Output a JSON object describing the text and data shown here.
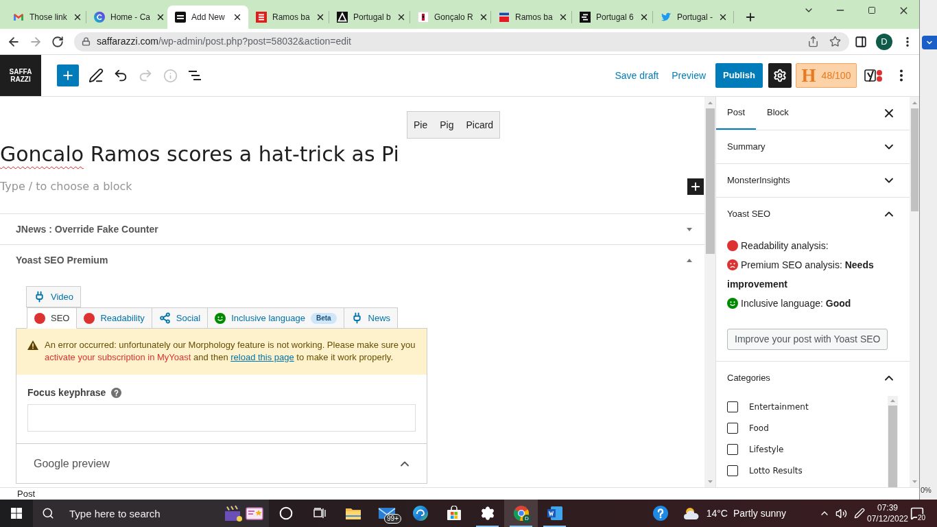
{
  "browser": {
    "tabs": [
      {
        "title": "Those link",
        "kind": "gmail",
        "selected": false
      },
      {
        "title": "Home - Ca",
        "kind": "canva",
        "selected": false
      },
      {
        "title": "Add New",
        "kind": "site",
        "selected": true
      },
      {
        "title": "Ramos ba",
        "kind": "red-bars",
        "selected": false
      },
      {
        "title": "Portugal b",
        "kind": "triangle",
        "selected": false
      },
      {
        "title": "Gonçalo R",
        "kind": "flag",
        "selected": false
      },
      {
        "title": "Ramos ba",
        "kind": "news",
        "selected": false
      },
      {
        "title": "Portugal 6",
        "kind": "dark-bars",
        "selected": false
      },
      {
        "title": "Portugal -",
        "kind": "bird",
        "selected": false
      }
    ],
    "nav": [
      {
        "kind": "back",
        "disabled": false
      },
      {
        "kind": "forward",
        "disabled": true
      },
      {
        "kind": "reload",
        "disabled": false
      }
    ],
    "url": {
      "host": "saffarazzi.com",
      "path": "/wp-admin/post.php?post=58032&action=edit"
    },
    "profile": "D"
  },
  "editor": {
    "logo": [
      "SAFFA",
      "RAZZI"
    ],
    "tools": [
      {
        "kind": "pen",
        "disabled": false
      },
      {
        "kind": "undo",
        "disabled": false
      },
      {
        "kind": "redo",
        "disabled": true
      },
      {
        "kind": "info",
        "disabled": true
      },
      {
        "kind": "list",
        "disabled": false
      }
    ],
    "save_draft": "Save draft",
    "preview": "Preview",
    "publish": "Publish",
    "score": {
      "logo": "H",
      "value": "48/100"
    }
  },
  "suggestions": [
    "Pie",
    "Pig",
    "Picard"
  ],
  "post": {
    "title": [
      {
        "text": "Goncalo",
        "misspelled": true
      },
      {
        "text": " Ramos scores a hat-trick as Pi",
        "misspelled": false
      }
    ],
    "placeholder": "Type / to choose a block"
  },
  "meta_boxes": [
    {
      "title": "JNews : Override Fake Counter",
      "expanded": false
    },
    {
      "title": "Yoast SEO Premium",
      "expanded": true,
      "tab_rows": [
        [
          {
            "label": "Video",
            "kind": "plug",
            "selected": false
          }
        ],
        [
          {
            "label": "SEO",
            "kind": "dot",
            "color": "#dc3232",
            "selected": true
          },
          {
            "label": "Readability",
            "kind": "dot",
            "color": "#dc3232",
            "selected": false
          },
          {
            "label": "Social",
            "kind": "share",
            "selected": false
          },
          {
            "label": "Inclusive language",
            "kind": "smile",
            "color": "#008a00",
            "badge": "Beta",
            "selected": false
          },
          {
            "label": "News",
            "kind": "plug",
            "selected": false
          }
        ]
      ],
      "warning": {
        "text_before": "An error occurred: unfortunately our Morphology feature is not working. Please make sure you ",
        "subscription_link": "activate your subscription in MyYoast",
        "text_middle": " and then ",
        "reload_link": "reload this page",
        "text_after": " to make it work properly."
      },
      "focus_keyphrase": {
        "label": "Focus keyphrase"
      },
      "google_preview": {
        "title": "Google preview",
        "expanded": true
      }
    }
  ],
  "footer": {
    "breadcrumb": "Post"
  },
  "sidebar": {
    "tabs": [
      {
        "label": "Post",
        "selected": true
      },
      {
        "label": "Block",
        "selected": false
      }
    ],
    "panels": [
      {
        "title": "Summary",
        "expanded": false
      },
      {
        "title": "MonsterInsights",
        "expanded": false
      },
      {
        "title": "Yoast SEO",
        "expanded": true,
        "analyses": [
          {
            "kind": "dot",
            "color": "#dc3232",
            "text": "Readability analysis:"
          },
          {
            "kind": "sad",
            "color": "#dc3232",
            "text": "Premium SEO analysis: **Needs improvement**"
          },
          {
            "kind": "smile",
            "color": "#008a00",
            "text": "Inclusive language: **Good**"
          }
        ],
        "button": "Improve your post with Yoast SEO"
      },
      {
        "title": "Categories",
        "expanded": true,
        "items": [
          {
            "label": "Entertainment",
            "checked": false
          },
          {
            "label": "Food",
            "checked": false
          },
          {
            "label": "Lifestyle",
            "checked": false
          },
          {
            "label": "Lotto Results",
            "checked": false
          }
        ]
      }
    ]
  },
  "background_window": {
    "zoom": "0%"
  },
  "taskbar": {
    "search_placeholder": "Type here to search",
    "apps": [
      {
        "kind": "cortana",
        "active": false,
        "running": false
      },
      {
        "kind": "task-view",
        "active": false,
        "running": false
      },
      {
        "kind": "explorer",
        "active": false,
        "running": false
      },
      {
        "kind": "mail",
        "badge": "99+",
        "active": false,
        "running": false
      },
      {
        "kind": "edge",
        "active": false,
        "running": false
      },
      {
        "kind": "store",
        "active": false,
        "running": false
      },
      {
        "kind": "settings",
        "active": false,
        "running": true
      },
      {
        "kind": "chrome",
        "badge": "D",
        "active": true,
        "running": true
      },
      {
        "kind": "word",
        "active": false,
        "running": true
      }
    ],
    "weather": {
      "temperature": "14°C",
      "condition": "Partly sunny"
    },
    "time": "07:39",
    "date": "07/12/2022",
    "notifications": "20"
  }
}
